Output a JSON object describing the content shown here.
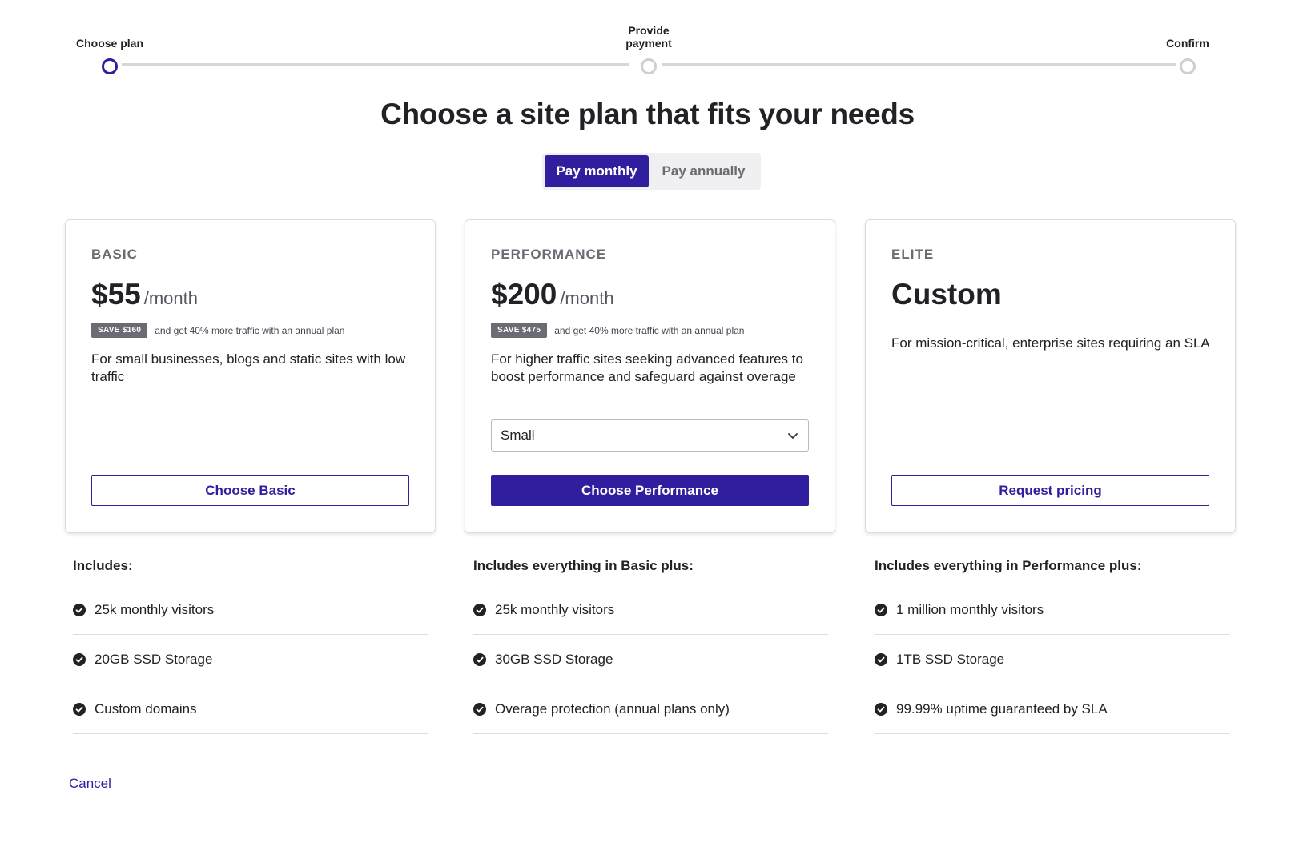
{
  "stepper": {
    "steps": [
      {
        "label": "Choose plan",
        "state": "active"
      },
      {
        "label": "Provide\npayment",
        "state": "pending"
      },
      {
        "label": "Confirm",
        "state": "pending"
      }
    ]
  },
  "heading": "Choose a site plan that fits your needs",
  "billing_toggle": {
    "monthly": "Pay monthly",
    "annually": "Pay annually",
    "selected": "monthly"
  },
  "plans": [
    {
      "tier": "BASIC",
      "price": "$55",
      "period": "/month",
      "save_badge": "SAVE $160",
      "save_note": "and get 40% more traffic with an annual plan",
      "description": "For small businesses, blogs and static sites with low traffic",
      "button": "Choose Basic",
      "includes_title": "Includes:",
      "features": [
        "25k monthly visitors",
        "20GB SSD Storage",
        "Custom domains"
      ]
    },
    {
      "tier": "PERFORMANCE",
      "price": "$200",
      "period": "/month",
      "save_badge": "SAVE $475",
      "save_note": "and get 40% more traffic with an annual plan",
      "description": "For higher traffic sites seeking advanced features to boost performance and safeguard against overage",
      "size_select": "Small",
      "button": "Choose Performance",
      "includes_title": "Includes everything in Basic plus:",
      "features": [
        "25k monthly visitors",
        "30GB SSD Storage",
        "Overage protection (annual plans only)"
      ]
    },
    {
      "tier": "ELITE",
      "price": "Custom",
      "description": "For mission-critical, enterprise sites requiring an SLA",
      "button": "Request pricing",
      "includes_title": "Includes everything in Performance plus:",
      "features": [
        "1 million monthly visitors",
        "1TB SSD Storage",
        "99.99% uptime guaranteed by SLA"
      ]
    }
  ],
  "cancel": "Cancel",
  "colors": {
    "accent": "#2f1f9e",
    "badge": "#6b6b73",
    "border": "#dcdce0"
  }
}
